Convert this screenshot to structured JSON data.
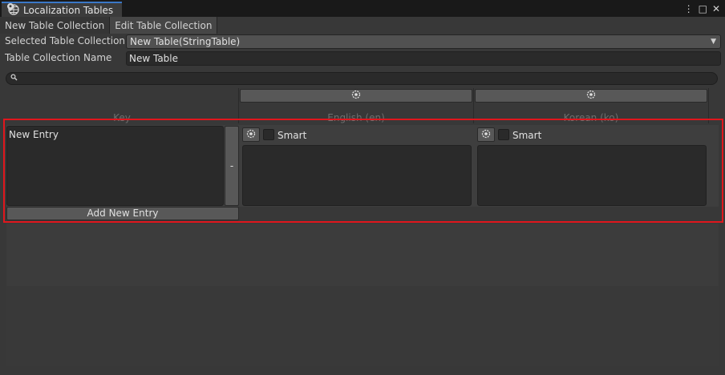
{
  "window": {
    "title": "Localization Tables",
    "controls": {
      "menu": "⋮",
      "maximize": "□",
      "close": "✕"
    }
  },
  "mode_tabs": [
    {
      "label": "New Table Collection",
      "active": false
    },
    {
      "label": "Edit Table Collection",
      "active": true
    }
  ],
  "fields": {
    "selected_collection_label": "Selected Table Collection",
    "selected_collection_value": "New Table(StringTable)",
    "collection_name_label": "Table Collection Name",
    "collection_name_value": "New Table"
  },
  "table": {
    "key_header": "Key",
    "locales": [
      {
        "header": "English (en)",
        "smart_label": "Smart",
        "smart_checked": false,
        "value": ""
      },
      {
        "header": "Korean (ko)",
        "smart_label": "Smart",
        "smart_checked": false,
        "value": ""
      }
    ],
    "entries": [
      {
        "key": "New Entry",
        "remove_label": "-"
      }
    ],
    "add_entry_label": "Add New Entry"
  },
  "colors": {
    "highlight": "#e0161d",
    "tab_accent": "#3a78c8"
  }
}
